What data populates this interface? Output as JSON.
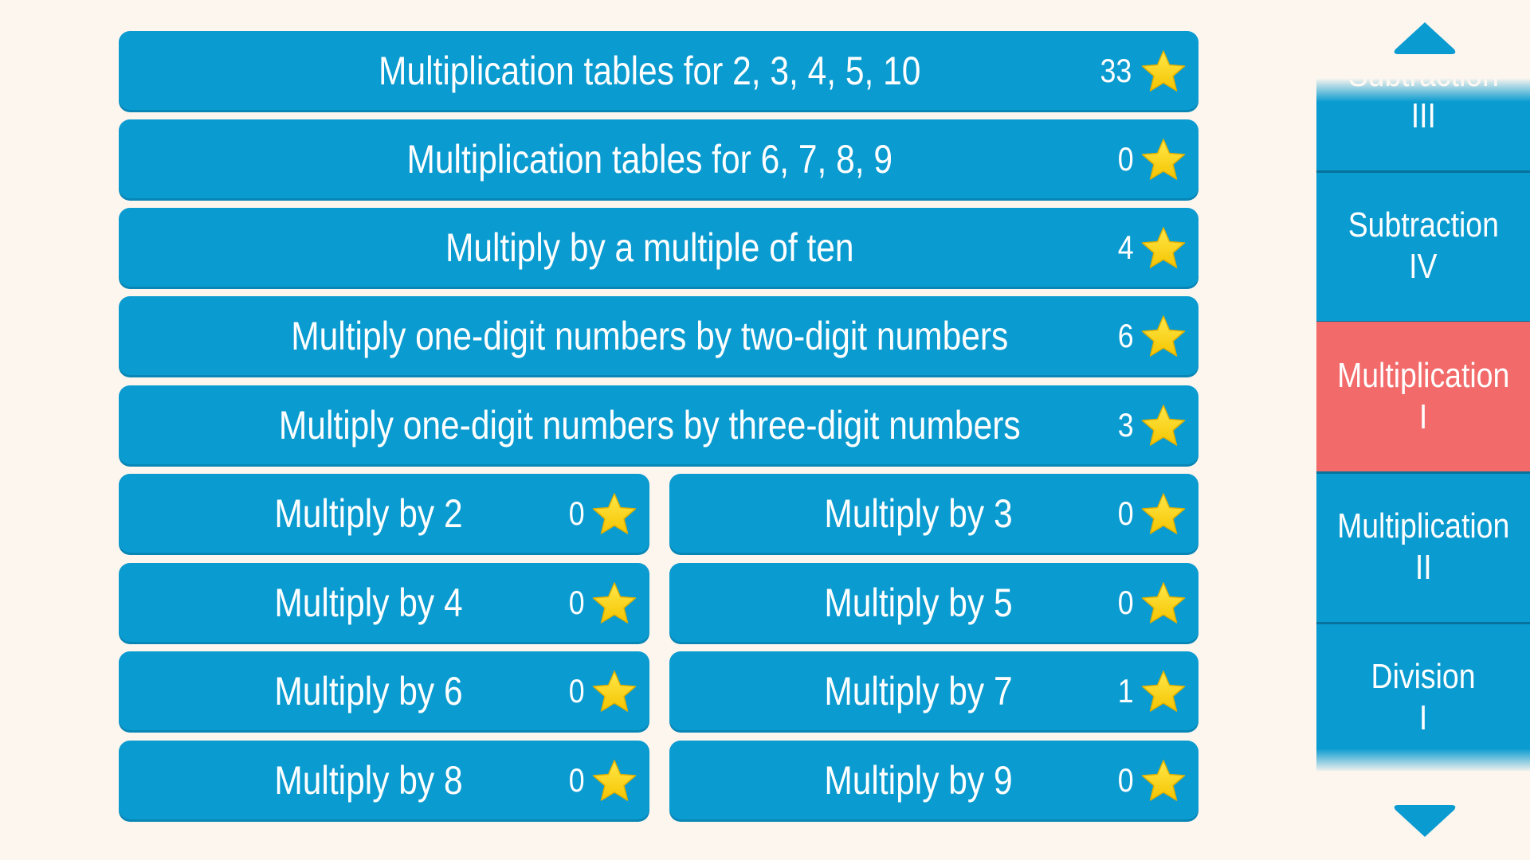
{
  "colors": {
    "button": "#0a9bd0",
    "active": "#f26a6a",
    "background": "#fdf6ef",
    "star": "#ffd400"
  },
  "full_rows": [
    {
      "label": "Multiplication tables for 2, 3, 4, 5, 10",
      "stars": "33"
    },
    {
      "label": "Multiplication tables for 6, 7, 8, 9",
      "stars": "0"
    },
    {
      "label": "Multiply by a multiple of ten",
      "stars": "4"
    },
    {
      "label": "Multiply one-digit numbers by two-digit numbers",
      "stars": "6"
    },
    {
      "label": "Multiply one-digit numbers by three-digit numbers",
      "stars": "3"
    }
  ],
  "half_rows": [
    {
      "label": "Multiply by 2",
      "stars": "0"
    },
    {
      "label": "Multiply by 3",
      "stars": "0"
    },
    {
      "label": "Multiply by 4",
      "stars": "0"
    },
    {
      "label": "Multiply by 5",
      "stars": "0"
    },
    {
      "label": "Multiply by 6",
      "stars": "0"
    },
    {
      "label": "Multiply by 7",
      "stars": "1"
    },
    {
      "label": "Multiply by 8",
      "stars": "0"
    },
    {
      "label": "Multiply by 9",
      "stars": "0"
    }
  ],
  "sidebar": {
    "items": [
      {
        "line1": "Subtraction",
        "line2": "III"
      },
      {
        "line1": "Subtraction",
        "line2": "IV"
      },
      {
        "line1": "Multiplication",
        "line2": "I",
        "active": true
      },
      {
        "line1": "Multiplication",
        "line2": "II"
      },
      {
        "line1": "Division",
        "line2": "I"
      }
    ],
    "up_icon": "triangle-up-icon",
    "down_icon": "triangle-down-icon"
  }
}
